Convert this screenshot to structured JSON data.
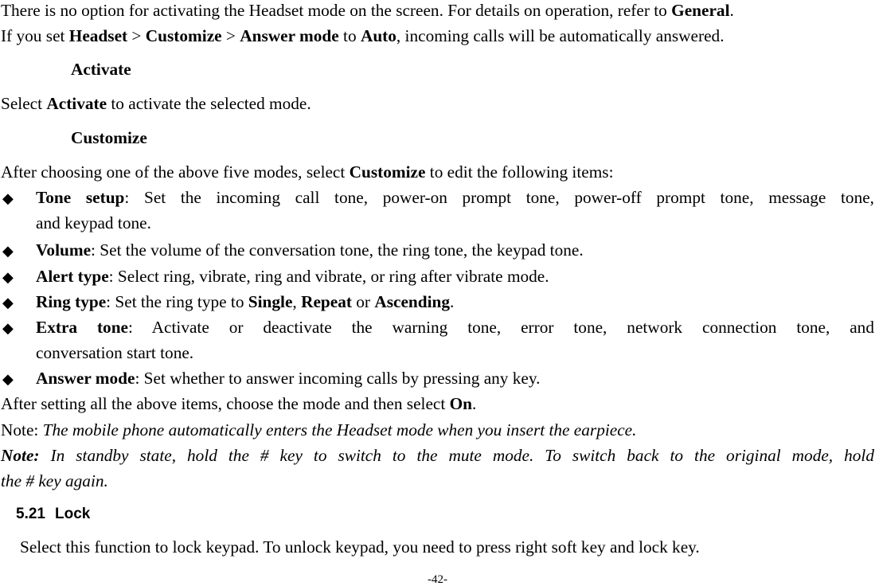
{
  "intro": {
    "line1": {
      "text": "There is no option for activating the Headset mode on the screen. For details on operation, refer to ",
      "bold": "General",
      "end": "."
    },
    "line2": {
      "p1": "If you set ",
      "b1": "Headset",
      "p2": " > ",
      "b2": "Customize",
      "p3": " > ",
      "b3": "Answer mode",
      "p4": " to ",
      "b4": "Auto",
      "p5": ", incoming calls will be automatically answered."
    }
  },
  "activate": {
    "heading": "Activate",
    "p1": "Select ",
    "b1": "Activate",
    "p2": " to activate the selected mode."
  },
  "customize": {
    "heading": "Customize",
    "p1": "After choosing one of the above five modes, select ",
    "b1": "Customize",
    "p2": " to edit the following items:",
    "items": [
      {
        "label": "Tone setup",
        "text_line1": ": Set the incoming call tone, power-on prompt tone, power-off prompt tone, message tone,",
        "text_line2": "and keypad tone."
      },
      {
        "label": "Volume",
        "text": ": Set the volume of the conversation tone, the ring tone, the keypad tone."
      },
      {
        "label": "Alert type",
        "text": ": Select ring, vibrate, ring and vibrate, or ring after vibrate mode."
      },
      {
        "label": "Ring type",
        "p1": ": Set the ring type to ",
        "b1": "Single",
        "p2": ", ",
        "b2": "Repeat",
        "p3": " or ",
        "b3": "Ascending",
        "p4": "."
      },
      {
        "label": "Extra tone",
        "text_line1": ": Activate or deactivate the warning tone, error tone, network connection tone, and",
        "text_line2": "conversation start tone."
      },
      {
        "label": "Answer mode",
        "text": ": Set whether to answer incoming calls by pressing any key."
      }
    ],
    "after": {
      "p1": "After setting all the above items, choose the mode and then select ",
      "b1": "On",
      "p2": "."
    }
  },
  "notes": {
    "note1_label": "Note: ",
    "note1_text": "The mobile phone automatically enters the Headset mode when you insert the earpiece.",
    "note2_label": "Note:",
    "note2_line1": " In standby state, hold the # key to switch to the mute mode. To switch back to the original mode, hold",
    "note2_line2": "the # key again."
  },
  "section": {
    "number": "5.21",
    "title": "Lock",
    "body": "Select this function to lock keypad. To unlock keypad, you need to press right soft key and lock key."
  },
  "page_number": "-42-"
}
